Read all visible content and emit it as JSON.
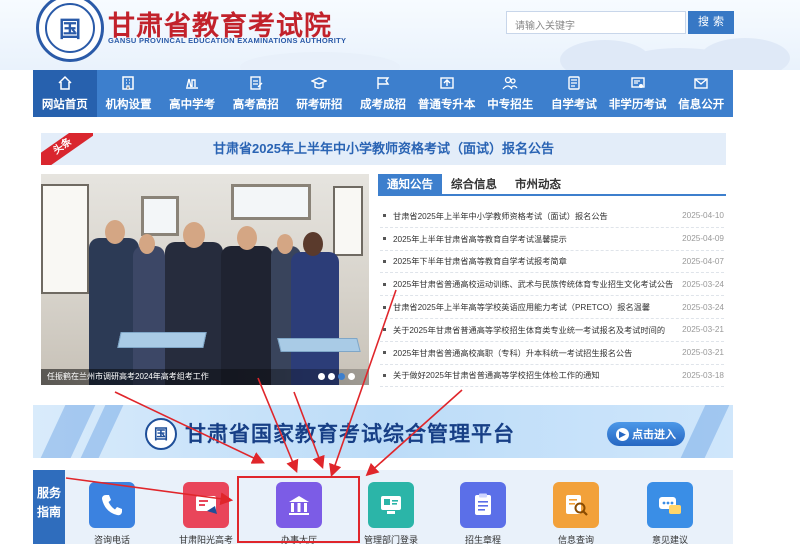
{
  "header": {
    "title": "甘肃省教育考试院",
    "subtitle": "GANSU PROVINCAL EDUCATION EXAMINATIONS AUTHORITY",
    "emblem_glyph": "国",
    "search_placeholder": "请输入关键字",
    "search_button": "搜索"
  },
  "nav": {
    "items": [
      {
        "label": "网站首页",
        "icon": "home-icon"
      },
      {
        "label": "机构设置",
        "icon": "building-icon"
      },
      {
        "label": "高中学考",
        "icon": "books-icon"
      },
      {
        "label": "高考高招",
        "icon": "pen-paper-icon"
      },
      {
        "label": "研考研招",
        "icon": "graduation-cap-icon"
      },
      {
        "label": "成考成招",
        "icon": "flag-icon"
      },
      {
        "label": "普通专升本",
        "icon": "upgrade-icon"
      },
      {
        "label": "中专招生",
        "icon": "people-icon"
      },
      {
        "label": "自学考试",
        "icon": "book-icon"
      },
      {
        "label": "非学历考试",
        "icon": "certificate-icon"
      },
      {
        "label": "信息公开",
        "icon": "mail-icon"
      }
    ]
  },
  "headline": {
    "tag": "头条",
    "text": "甘肃省2025年上半年中小学教师资格考试（面试）报名公告"
  },
  "photo": {
    "caption": "任振鹤在兰州市调研高考2024年高考组考工作"
  },
  "news": {
    "tabs": [
      "通知公告",
      "综合信息",
      "市州动态"
    ],
    "items": [
      {
        "title": "甘肃省2025年上半年中小学教师资格考试（面试）报名公告",
        "date": "2025-04-10"
      },
      {
        "title": "2025年上半年甘肃省高等教育自学考试温馨提示",
        "date": "2025-04-09"
      },
      {
        "title": "2025年下半年甘肃省高等教育自学考试报考简章",
        "date": "2025-04-07"
      },
      {
        "title": "2025年甘肃省普通高校运动训练、武术与民族传统体育专业招生文化考试公告",
        "date": "2025-03-24"
      },
      {
        "title": "甘肃省2025年上半年高等学校英语应用能力考试（PRETCO）报名温馨",
        "date": "2025-03-24"
      },
      {
        "title": "关于2025年甘肃省普通高等学校招生体育类专业统一考试报名及考试时间的",
        "date": "2025-03-21"
      },
      {
        "title": "2025年甘肃省普通高校高职（专科）升本科统一考试招生报名公告",
        "date": "2025-03-21"
      },
      {
        "title": "关于做好2025年甘肃省普通高等学校招生体检工作的通知",
        "date": "2025-03-18"
      }
    ]
  },
  "banner": {
    "emblem_glyph": "国",
    "title": "甘肃省国家教育考试综合管理平台",
    "enter_label": "点击进入"
  },
  "services": {
    "label_line1": "服务",
    "label_line2": "指南",
    "items": [
      {
        "label": "咨询电话",
        "icon": "phone-icon",
        "color": "#3b82e0"
      },
      {
        "label": "甘肃阳光高考",
        "icon": "sunshine-exam-icon",
        "color": "#e9455a"
      },
      {
        "label": "办事大厅",
        "icon": "service-hall-icon",
        "color": "#7c5ce6"
      },
      {
        "label": "管理部门登录",
        "icon": "admin-login-icon",
        "color": "#2bb5a8"
      },
      {
        "label": "招生章程",
        "icon": "clipboard-icon",
        "color": "#5b6fe8"
      },
      {
        "label": "信息查询",
        "icon": "search-doc-icon",
        "color": "#f2a13a"
      },
      {
        "label": "意见建议",
        "icon": "chat-icon",
        "color": "#3a8ee6"
      }
    ]
  },
  "colors": {
    "brand_red": "#c2222b",
    "nav_blue": "#3d7fcd",
    "highlight_red": "#e0262b"
  }
}
